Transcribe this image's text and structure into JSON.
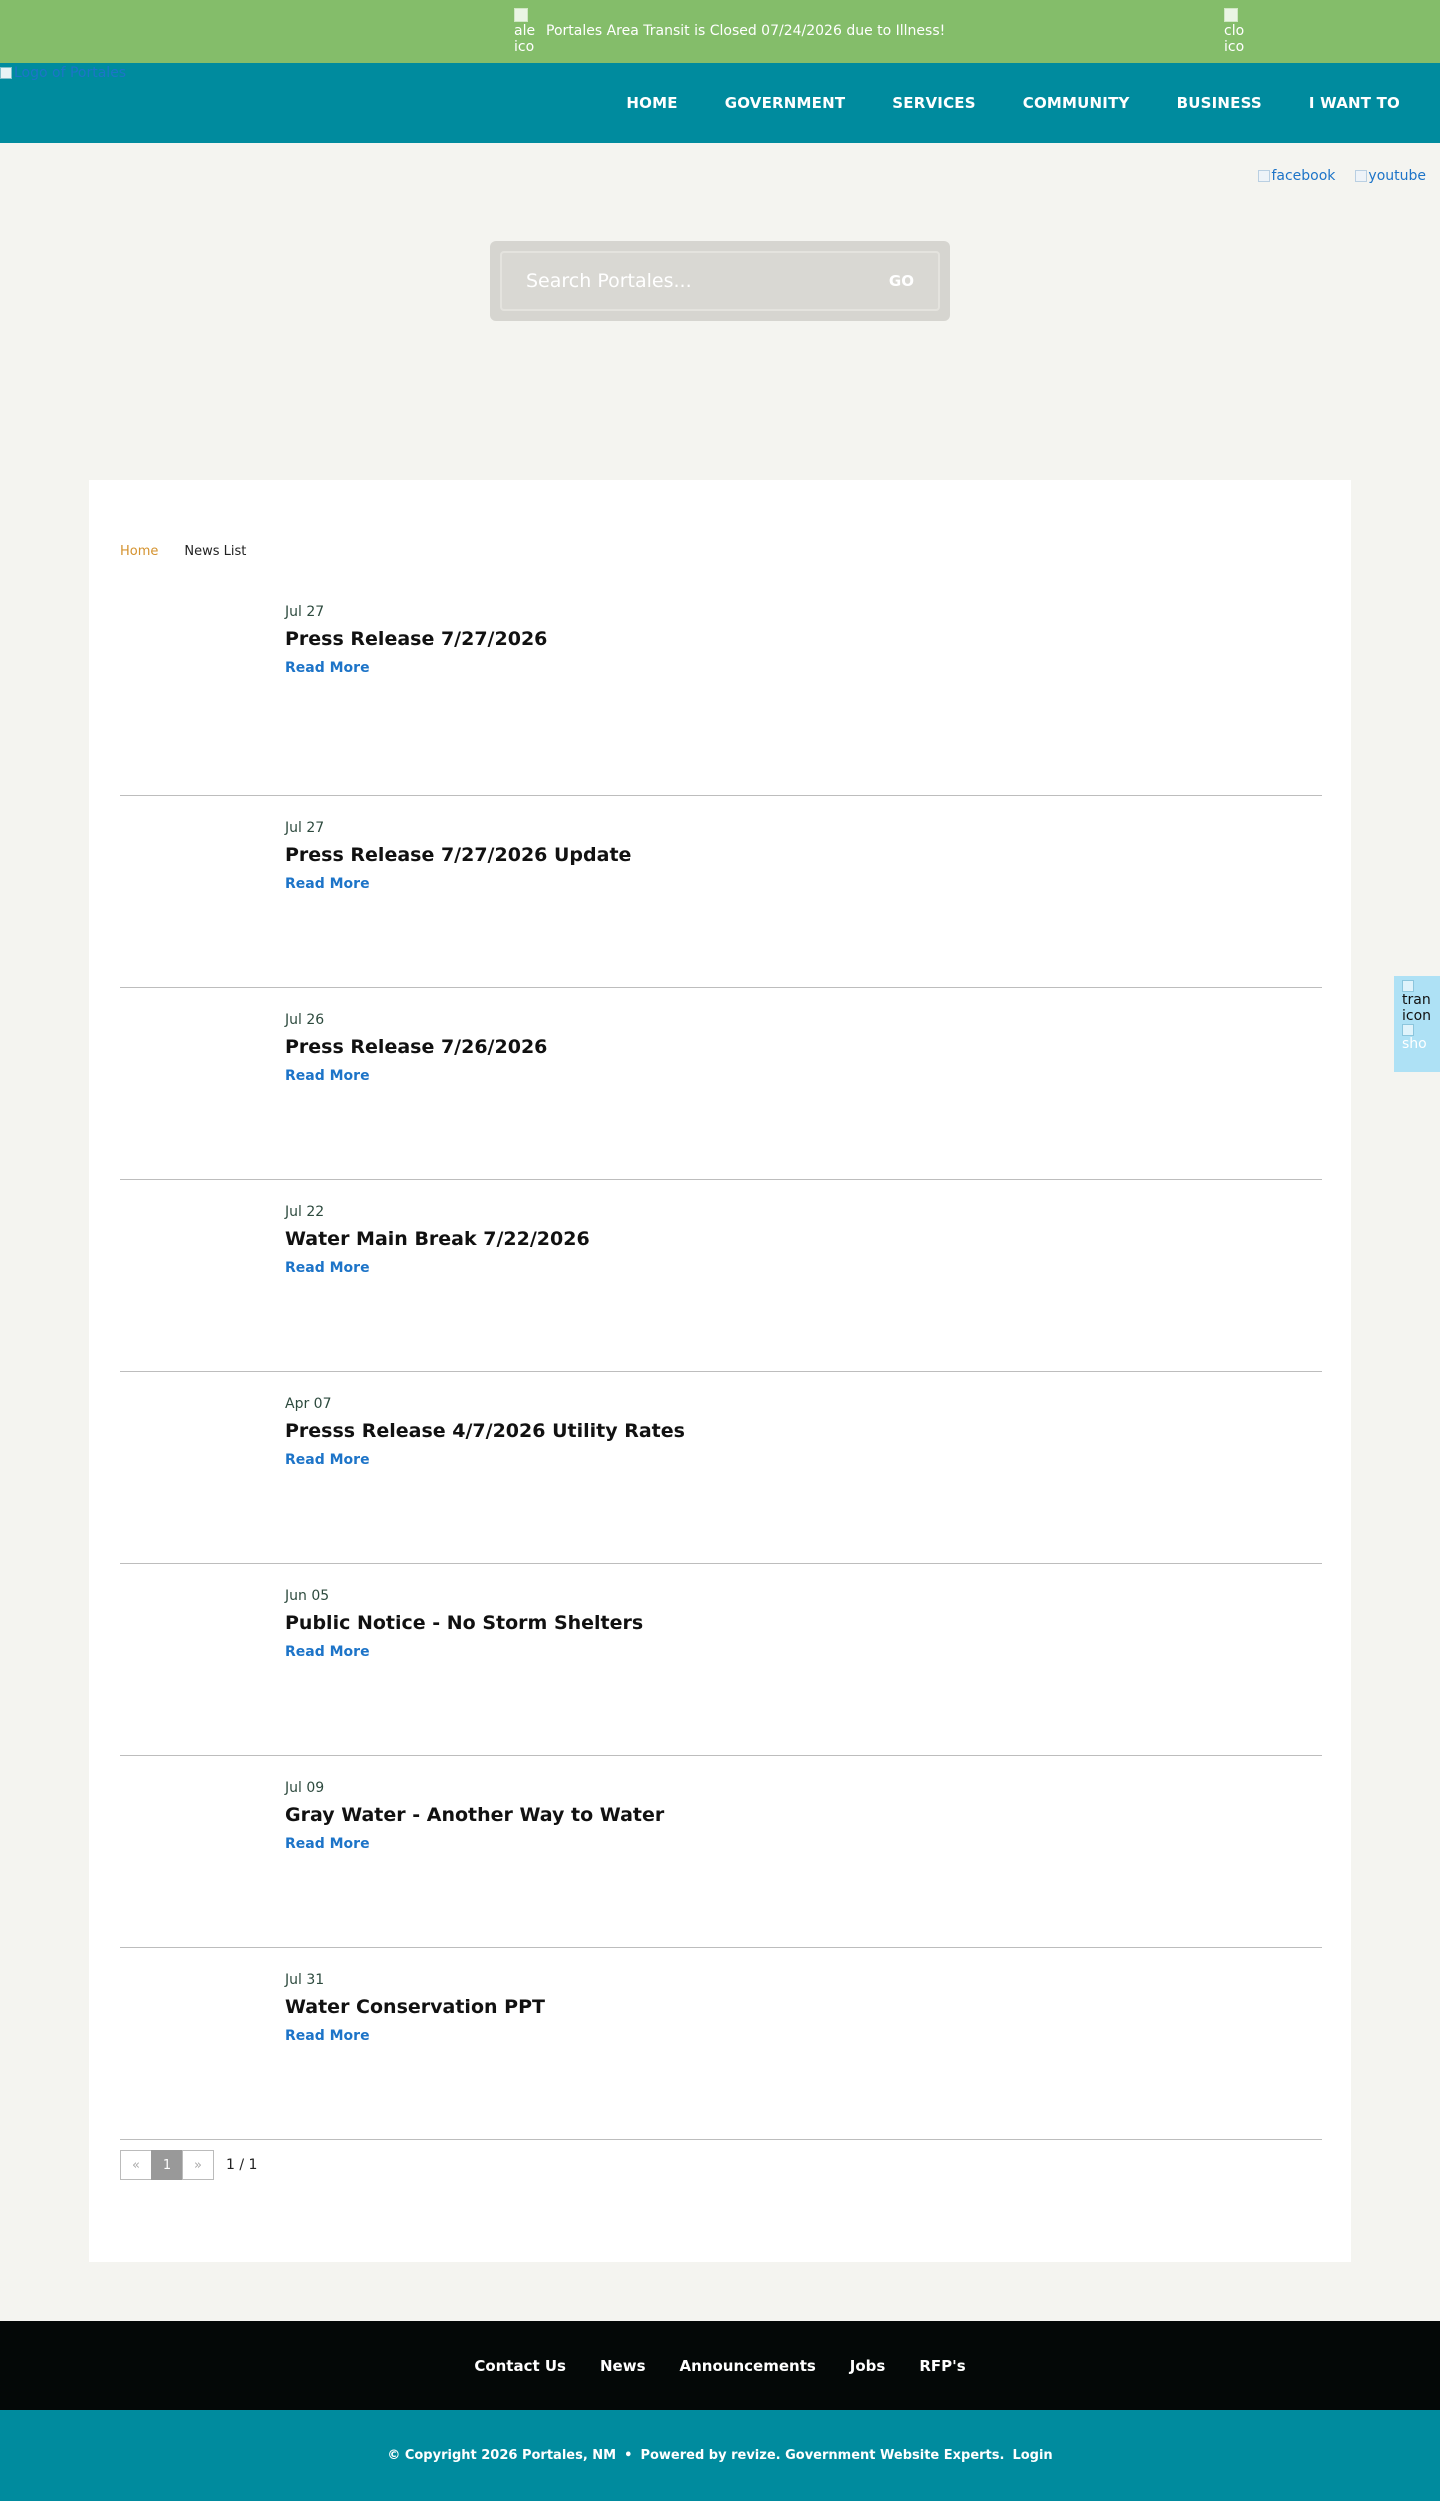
{
  "alert": {
    "icon_alt_lines": [
      "ale",
      "ico"
    ],
    "text": "Portales Area Transit is Closed 07/24/2026 due to Illness!",
    "close_alt_lines": [
      "clo",
      "ico"
    ]
  },
  "header": {
    "logo_alt": "Logo of Portales",
    "nav": [
      "HOME",
      "GOVERNMENT",
      "SERVICES",
      "COMMUNITY",
      "BUSINESS",
      "I WANT TO"
    ]
  },
  "social": {
    "facebook": "facebook",
    "youtube": "youtube"
  },
  "search": {
    "placeholder": "Search Portales...",
    "go_label": "GO"
  },
  "side_float": {
    "line1": "tran",
    "line2": "icon",
    "line3": "sho"
  },
  "breadcrumb": {
    "home": "Home",
    "current": "News List"
  },
  "news": [
    {
      "date": "Jul 27",
      "title": "Press Release 7/27/2026",
      "more": "Read More"
    },
    {
      "date": "Jul 27",
      "title": "Press Release 7/27/2026 Update",
      "more": "Read More"
    },
    {
      "date": "Jul 26",
      "title": "Press Release 7/26/2026",
      "more": "Read More"
    },
    {
      "date": "Jul 22",
      "title": "Water Main Break 7/22/2026",
      "more": "Read More"
    },
    {
      "date": "Apr 07",
      "title": "Presss Release 4/7/2026 Utility Rates",
      "more": "Read More"
    },
    {
      "date": "Jun 05",
      "title": "Public Notice - No Storm Shelters",
      "more": "Read More"
    },
    {
      "date": "Jul 09",
      "title": "Gray Water - Another Way to Water",
      "more": "Read More"
    },
    {
      "date": "Jul 31",
      "title": "Water Conservation PPT",
      "more": "Read More"
    }
  ],
  "pagination": {
    "prev": "«",
    "current": "1",
    "next": "»",
    "count": "1 / 1"
  },
  "footer": {
    "links": [
      "Contact Us",
      "News",
      "Announcements",
      "Jobs",
      "RFP's"
    ],
    "copyright": "© Copyright 2026 Portales, NM",
    "separator": "•",
    "powered": "Powered by revize. Government Website Experts.",
    "login": "Login"
  }
}
